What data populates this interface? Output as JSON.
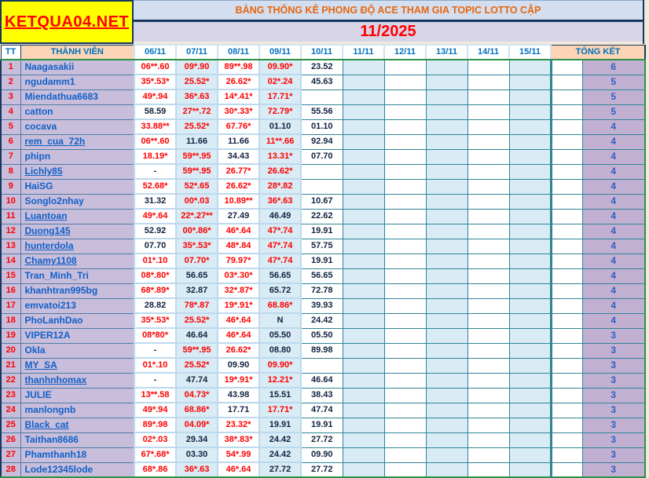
{
  "logo": {
    "text": "KETQUA04.NET"
  },
  "header": {
    "title": "BẢNG THỐNG KÊ PHONG ĐỘ ACE THAM GIA TOPIC  LOTTO CẬP",
    "month": "11/2025"
  },
  "columns": {
    "tt": "TT",
    "member": "THÀNH VIÊN",
    "dates": [
      "06/11",
      "07/11",
      "08/11",
      "09/11",
      "10/11",
      "11/11",
      "12/11",
      "13/11",
      "14/11",
      "15/11"
    ],
    "total": "TỔNG KẾT"
  },
  "colors": {
    "accent_orange": "#e8650c",
    "red_value": "#ff0000",
    "black_value": "#10233f",
    "member_blue": "#1060c8",
    "header_blue": "#0070c0",
    "lavender_name_bg": "#c8bddb",
    "purple_total_bg": "#c1b0d2",
    "peach_header_bg": "#fbd5b5",
    "pale_column_bg": "#d9ebf4",
    "green_border": "#2e9147",
    "teal_border": "#2f8597",
    "navy_border": "#17375d",
    "logo_bg": "#ffff00"
  },
  "rows": [
    {
      "tt": "1",
      "name": "Naagasakii",
      "underline": false,
      "values": [
        [
          "06**.60",
          1
        ],
        [
          "09*.90",
          1
        ],
        [
          "89**.98",
          1
        ],
        [
          "09.90*",
          1
        ],
        [
          "23.52",
          0
        ]
      ],
      "total": "6"
    },
    {
      "tt": "2",
      "name": "ngudamm1",
      "underline": false,
      "values": [
        [
          "35*.53*",
          1
        ],
        [
          "25.52*",
          1
        ],
        [
          "26.62*",
          1
        ],
        [
          "02*.24",
          1
        ],
        [
          "45.63",
          0
        ]
      ],
      "total": "5"
    },
    {
      "tt": "3",
      "name": "Miendathua6683",
      "underline": false,
      "values": [
        [
          "49*.94",
          1
        ],
        [
          "36*.63",
          1
        ],
        [
          "14*.41*",
          1
        ],
        [
          "17.71*",
          1
        ],
        [
          "",
          0
        ]
      ],
      "total": "5"
    },
    {
      "tt": "4",
      "name": "catton",
      "underline": false,
      "values": [
        [
          "58.59",
          0
        ],
        [
          "27**.72",
          1
        ],
        [
          "30*.33*",
          1
        ],
        [
          "72.79*",
          1
        ],
        [
          "55.56",
          0
        ]
      ],
      "total": "5"
    },
    {
      "tt": "5",
      "name": "cocava",
      "underline": false,
      "values": [
        [
          "33.88**",
          1
        ],
        [
          "25.52*",
          1
        ],
        [
          "67.76*",
          1
        ],
        [
          "01.10",
          0
        ],
        [
          "01.10",
          0
        ]
      ],
      "total": "4"
    },
    {
      "tt": "6",
      "name": "rem_cua_72h",
      "underline": true,
      "values": [
        [
          "06**.60",
          1
        ],
        [
          "11.66",
          0
        ],
        [
          "11.66",
          0
        ],
        [
          "11**.66",
          1
        ],
        [
          "92.94",
          0
        ]
      ],
      "total": "4"
    },
    {
      "tt": "7",
      "name": "phipn",
      "underline": false,
      "values": [
        [
          "18.19*",
          1
        ],
        [
          "59**.95",
          1
        ],
        [
          "34.43",
          0
        ],
        [
          "13.31*",
          1
        ],
        [
          "07.70",
          0
        ]
      ],
      "total": "4"
    },
    {
      "tt": "8",
      "name": "Lichly85",
      "underline": true,
      "values": [
        [
          "-",
          0
        ],
        [
          "59**.95",
          1
        ],
        [
          "26.77*",
          1
        ],
        [
          "26.62*",
          1
        ],
        [
          "",
          0
        ]
      ],
      "total": "4"
    },
    {
      "tt": "9",
      "name": "HaiSG",
      "underline": false,
      "values": [
        [
          "52.68*",
          1
        ],
        [
          "52*.65",
          1
        ],
        [
          "26.62*",
          1
        ],
        [
          "28*.82",
          1
        ],
        [
          "",
          0
        ]
      ],
      "total": "4"
    },
    {
      "tt": "10",
      "name": "Songlo2nhay",
      "underline": false,
      "values": [
        [
          "31.32",
          0
        ],
        [
          "00*.03",
          1
        ],
        [
          "10.89**",
          1
        ],
        [
          "36*.63",
          1
        ],
        [
          "10.67",
          0
        ]
      ],
      "total": "4"
    },
    {
      "tt": "11",
      "name": "Luantoan",
      "underline": true,
      "values": [
        [
          "49*.64",
          1
        ],
        [
          "22*.27**",
          1
        ],
        [
          "27.49",
          0
        ],
        [
          "46.49",
          0
        ],
        [
          "22.62",
          0
        ]
      ],
      "total": "4"
    },
    {
      "tt": "12",
      "name": "Duong145",
      "underline": true,
      "values": [
        [
          "52.92",
          0
        ],
        [
          "00*.86*",
          1
        ],
        [
          "46*.64",
          1
        ],
        [
          "47*.74",
          1
        ],
        [
          "19.91",
          0
        ]
      ],
      "total": "4"
    },
    {
      "tt": "13",
      "name": "hunterdola",
      "underline": true,
      "values": [
        [
          "07.70",
          0
        ],
        [
          "35*.53*",
          1
        ],
        [
          "48*.84",
          1
        ],
        [
          "47*.74",
          1
        ],
        [
          "57.75",
          0
        ]
      ],
      "total": "4"
    },
    {
      "tt": "14",
      "name": "Chamy1108",
      "underline": true,
      "values": [
        [
          "01*.10",
          1
        ],
        [
          "07.70*",
          1
        ],
        [
          "79.97*",
          1
        ],
        [
          "47*.74",
          1
        ],
        [
          "19.91",
          0
        ]
      ],
      "total": "4"
    },
    {
      "tt": "15",
      "name": "Tran_Minh_Tri",
      "underline": false,
      "values": [
        [
          "08*.80*",
          1
        ],
        [
          "56.65",
          0
        ],
        [
          "03*.30*",
          1
        ],
        [
          "56.65",
          0
        ],
        [
          "56.65",
          0
        ]
      ],
      "total": "4"
    },
    {
      "tt": "16",
      "name": "khanhtran995bg",
      "underline": false,
      "values": [
        [
          "68*.89*",
          1
        ],
        [
          "32.87",
          0
        ],
        [
          "32*.87*",
          1
        ],
        [
          "65.72",
          0
        ],
        [
          "72.78",
          0
        ]
      ],
      "total": "4"
    },
    {
      "tt": "17",
      "name": "emvatoi213",
      "underline": false,
      "values": [
        [
          "28.82",
          0
        ],
        [
          "78*.87",
          1
        ],
        [
          "19*.91*",
          1
        ],
        [
          "68.86*",
          1
        ],
        [
          "39.93",
          0
        ]
      ],
      "total": "4"
    },
    {
      "tt": "18",
      "name": "PhoLanhDao",
      "underline": false,
      "values": [
        [
          "35*.53*",
          1
        ],
        [
          "25.52*",
          1
        ],
        [
          "46*.64",
          1
        ],
        [
          "N",
          0
        ],
        [
          "24.42",
          0
        ]
      ],
      "total": "4"
    },
    {
      "tt": "19",
      "name": "VIPER12A",
      "underline": false,
      "values": [
        [
          "08*80*",
          1
        ],
        [
          "46.64",
          0
        ],
        [
          "46*.64",
          1
        ],
        [
          "05.50",
          0
        ],
        [
          "05.50",
          0
        ]
      ],
      "total": "3"
    },
    {
      "tt": "20",
      "name": "Okla",
      "underline": false,
      "values": [
        [
          "-",
          0
        ],
        [
          "59**.95",
          1
        ],
        [
          "26.62*",
          1
        ],
        [
          "08.80",
          0
        ],
        [
          "89.98",
          0
        ]
      ],
      "total": "3"
    },
    {
      "tt": "21",
      "name": "MY_SA",
      "underline": true,
      "values": [
        [
          "01*.10",
          1
        ],
        [
          "25.52*",
          1
        ],
        [
          "09.90",
          0
        ],
        [
          "09.90*",
          1
        ],
        [
          "",
          0
        ]
      ],
      "total": "3"
    },
    {
      "tt": "22",
      "name": "thanhnhomax",
      "underline": true,
      "values": [
        [
          "-",
          0
        ],
        [
          "47.74",
          0
        ],
        [
          "19*.91*",
          1
        ],
        [
          "12.21*",
          1
        ],
        [
          "46.64",
          0
        ]
      ],
      "total": "3"
    },
    {
      "tt": "23",
      "name": "JULIE",
      "underline": false,
      "values": [
        [
          "13**.58",
          1
        ],
        [
          "04.73*",
          1
        ],
        [
          "43.98",
          0
        ],
        [
          "15.51",
          0
        ],
        [
          "38.43",
          0
        ]
      ],
      "total": "3"
    },
    {
      "tt": "24",
      "name": "manlongnb",
      "underline": false,
      "values": [
        [
          "49*.94",
          1
        ],
        [
          "68.86*",
          1
        ],
        [
          "17.71",
          0
        ],
        [
          "17.71*",
          1
        ],
        [
          "47.74",
          0
        ]
      ],
      "total": "3"
    },
    {
      "tt": "25",
      "name": "Black_cat",
      "underline": true,
      "values": [
        [
          "89*.98",
          1
        ],
        [
          "04.09*",
          1
        ],
        [
          "23.32*",
          1
        ],
        [
          "19.91",
          0
        ],
        [
          "19.91",
          0
        ]
      ],
      "total": "3"
    },
    {
      "tt": "26",
      "name": "Taithan8686",
      "underline": false,
      "values": [
        [
          "02*.03",
          1
        ],
        [
          "29.34",
          0
        ],
        [
          "38*.83*",
          1
        ],
        [
          "24.42",
          0
        ],
        [
          "27.72",
          0
        ]
      ],
      "total": "3"
    },
    {
      "tt": "27",
      "name": "Phamthanh18",
      "underline": false,
      "values": [
        [
          "67*.68*",
          1
        ],
        [
          "03.30",
          0
        ],
        [
          "54*.99",
          1
        ],
        [
          "24.42",
          0
        ],
        [
          "09.90",
          0
        ]
      ],
      "total": "3"
    },
    {
      "tt": "28",
      "name": "Lode12345lode",
      "underline": false,
      "values": [
        [
          "68*.86",
          1
        ],
        [
          "36*.63",
          1
        ],
        [
          "46*.64",
          1
        ],
        [
          "27.72",
          0
        ],
        [
          "27.72",
          0
        ]
      ],
      "total": "3"
    }
  ]
}
